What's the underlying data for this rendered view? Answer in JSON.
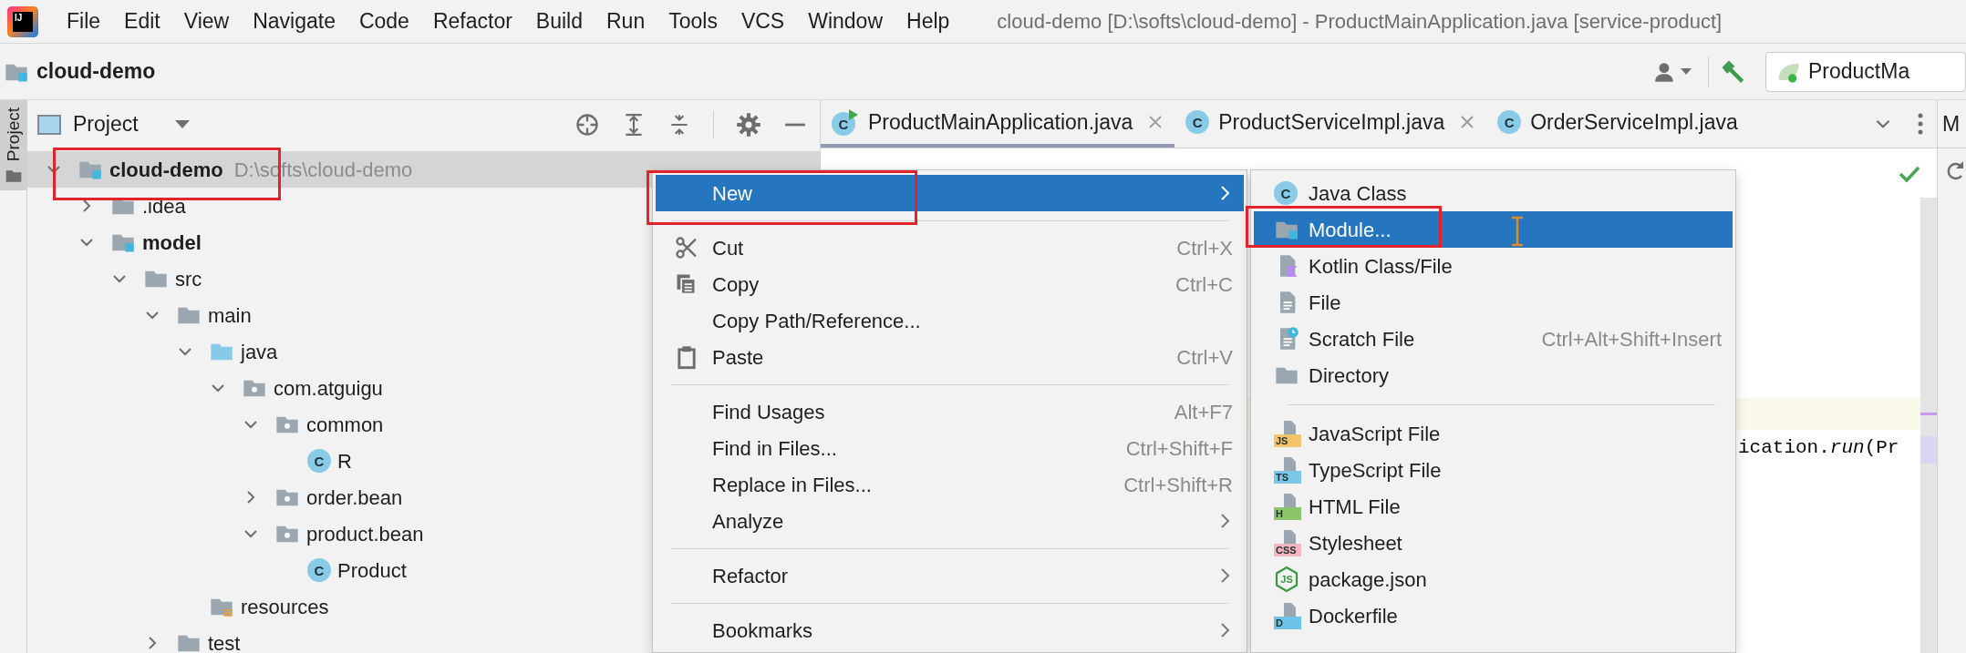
{
  "menu_bar": {
    "logo_text": "IJ",
    "items": [
      {
        "label": "File"
      },
      {
        "label": "Edit"
      },
      {
        "label": "View"
      },
      {
        "label": "Navigate"
      },
      {
        "label": "Code"
      },
      {
        "label": "Refactor"
      },
      {
        "label": "Build"
      },
      {
        "label": "Run"
      },
      {
        "label": "Tools"
      },
      {
        "label": "VCS"
      },
      {
        "label": "Window"
      },
      {
        "label": "Help"
      }
    ],
    "title": "cloud-demo [D:\\softs\\cloud-demo] - ProductMainApplication.java [service-product]"
  },
  "nav_bar": {
    "project": "cloud-demo",
    "run_config": "ProductMa"
  },
  "tool_stripe": {
    "label": "Project",
    "selected": true
  },
  "project_panel": {
    "title": "Project",
    "tree": [
      {
        "label": "cloud-demo",
        "kind": "module",
        "path": "D:\\softs\\cloud-demo",
        "expanded": true,
        "selected": true,
        "children": [
          {
            "label": ".idea",
            "kind": "folder",
            "expanded": false,
            "selected": false
          },
          {
            "label": "model",
            "kind": "module",
            "expanded": true,
            "selected": false,
            "children": [
              {
                "label": "src",
                "kind": "folder",
                "expanded": true,
                "selected": false,
                "children": [
                  {
                    "label": "main",
                    "kind": "folder",
                    "expanded": true,
                    "selected": false,
                    "children": [
                      {
                        "label": "java",
                        "kind": "source-folder",
                        "expanded": true,
                        "selected": false,
                        "children": [
                          {
                            "label": "com.atguigu",
                            "kind": "package",
                            "expanded": true,
                            "selected": false,
                            "children": [
                              {
                                "label": "common",
                                "kind": "package",
                                "expanded": true,
                                "selected": false,
                                "children": [
                                  {
                                    "label": "R",
                                    "kind": "class",
                                    "icon_text": "C",
                                    "selected": false
                                  }
                                ]
                              },
                              {
                                "label": "order.bean",
                                "kind": "package",
                                "expanded": false,
                                "selected": false
                              },
                              {
                                "label": "product.bean",
                                "kind": "package",
                                "expanded": true,
                                "selected": false,
                                "children": [
                                  {
                                    "label": "Product",
                                    "kind": "class",
                                    "icon_text": "C",
                                    "selected": false
                                  }
                                ]
                              }
                            ]
                          }
                        ]
                      },
                      {
                        "label": "resources",
                        "kind": "resources-folder",
                        "selected": false
                      }
                    ]
                  },
                  {
                    "label": "test",
                    "kind": "folder",
                    "expanded": false,
                    "selected": false
                  }
                ]
              }
            ]
          }
        ]
      }
    ]
  },
  "editor": {
    "tabs": [
      {
        "label": "ProductMainApplication.java",
        "kind": "runnable-class",
        "icon_text": "C",
        "selected": true,
        "close_button": true
      },
      {
        "label": "ProductServiceImpl.java",
        "kind": "class",
        "icon_text": "C",
        "selected": false,
        "close_button": true
      },
      {
        "label": "OrderServiceImpl.java",
        "kind": "class",
        "icon_text": "C",
        "selected": false,
        "close_button": false
      }
    ],
    "code_line": "ication.*run*(Pr"
  },
  "right_panel": {
    "label": "M"
  },
  "context_menu": {
    "items": [
      {
        "kind": "plain",
        "label": "New",
        "selected": true,
        "submenu": true
      },
      {
        "kind": "separator"
      },
      {
        "kind": "cut",
        "label": "Cut",
        "shortcut": "Ctrl+X",
        "selected": false,
        "submenu": false
      },
      {
        "kind": "copy",
        "label": "Copy",
        "shortcut": "Ctrl+C",
        "selected": false,
        "submenu": false
      },
      {
        "kind": "plain",
        "label": "Copy Path/Reference...",
        "selected": false,
        "submenu": false
      },
      {
        "kind": "paste",
        "label": "Paste",
        "shortcut": "Ctrl+V",
        "selected": false,
        "submenu": false
      },
      {
        "kind": "separator"
      },
      {
        "kind": "plain",
        "label": "Find Usages",
        "shortcut": "Alt+F7",
        "selected": false,
        "submenu": false
      },
      {
        "kind": "plain",
        "label": "Find in Files...",
        "shortcut": "Ctrl+Shift+F",
        "selected": false,
        "submenu": false
      },
      {
        "kind": "plain",
        "label": "Replace in Files...",
        "shortcut": "Ctrl+Shift+R",
        "selected": false,
        "submenu": false
      },
      {
        "kind": "plain",
        "label": "Analyze",
        "selected": false,
        "submenu": true
      },
      {
        "kind": "separator"
      },
      {
        "kind": "plain",
        "label": "Refactor",
        "selected": false,
        "submenu": true
      },
      {
        "kind": "separator"
      },
      {
        "kind": "plain",
        "label": "Bookmarks",
        "selected": false,
        "submenu": true
      }
    ]
  },
  "submenu": {
    "items": [
      {
        "kind": "class",
        "label": "Java Class",
        "icon_text": "C",
        "selected": false
      },
      {
        "kind": "module",
        "label": "Module...",
        "selected": true
      },
      {
        "kind": "kotlin",
        "label": "Kotlin Class/File",
        "selected": false
      },
      {
        "kind": "file",
        "label": "File",
        "selected": false
      },
      {
        "kind": "scratch",
        "label": "Scratch File",
        "shortcut": "Ctrl+Alt+Shift+Insert",
        "selected": false
      },
      {
        "kind": "folder",
        "label": "Directory",
        "selected": false
      },
      {
        "kind": "separator"
      },
      {
        "kind": "badge-file",
        "label": "JavaScript File",
        "icon_text": "JS",
        "color": "#f4c46a",
        "selected": false
      },
      {
        "kind": "badge-file",
        "label": "TypeScript File",
        "icon_text": "TS",
        "color": "#7cc7e8",
        "selected": false
      },
      {
        "kind": "badge-file",
        "label": "HTML File",
        "icon_text": "H",
        "color": "#8bc56b",
        "selected": false
      },
      {
        "kind": "badge-file",
        "label": "Stylesheet",
        "icon_text": "CSS",
        "color": "#f6b3c0",
        "selected": false
      },
      {
        "kind": "nodejs",
        "label": "package.json",
        "icon_text": "JS",
        "selected": false
      },
      {
        "kind": "badge-file",
        "label": "Dockerfile",
        "icon_text": "D",
        "color": "#6fc3e8",
        "selected": false
      }
    ]
  }
}
